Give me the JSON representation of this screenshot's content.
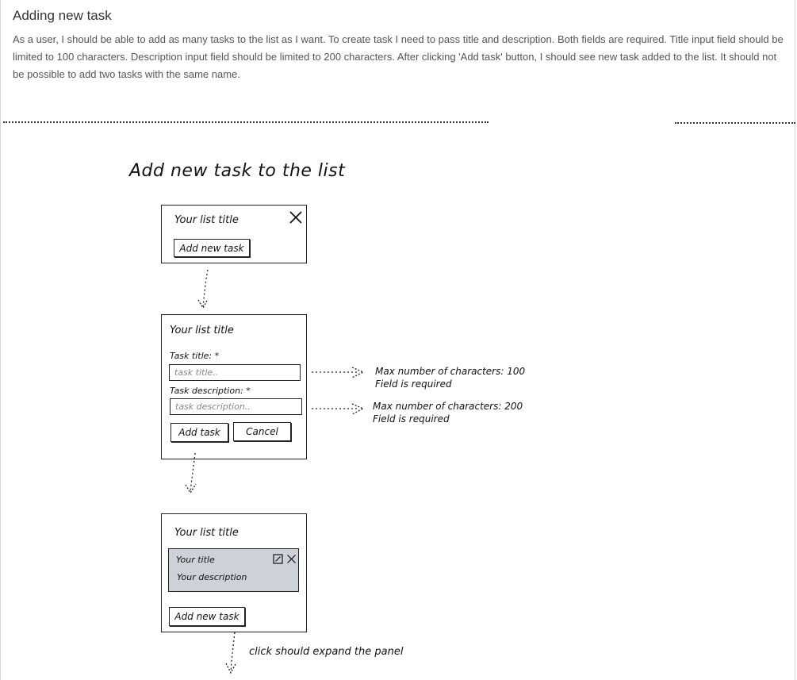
{
  "story": {
    "title": "Adding new task",
    "description": "As a user, I should be able to add as many tasks to the list as I want. To create task I need to pass title and description. Both fields are required. Title input field should be limited to 100 characters. Description input field should be limited to 200 characters. After clicking 'Add task' button, I should see new task added to the list. It should not be possible to add two tasks with the same name."
  },
  "sketch": {
    "heading": "Add new task to the list",
    "step1": {
      "list_title": "Your list title",
      "add_button": "Add new task",
      "close_icon": "close-icon"
    },
    "step2": {
      "list_title": "Your list title",
      "title_label": "Task title: *",
      "title_placeholder": "task title..",
      "description_label": "Task description: *",
      "description_placeholder": "task description..",
      "add_button": "Add task",
      "cancel_button": "Cancel",
      "title_note_line1": "Max number of characters: 100",
      "title_note_line2": "Field is required",
      "description_note_line1": "Max number of characters: 200",
      "description_note_line2": "Field is required"
    },
    "step3": {
      "list_title": "Your list title",
      "task_title": "Your title",
      "task_description": "Your description",
      "add_button": "Add new task",
      "edit_icon": "edit-icon",
      "delete_icon": "close-icon",
      "card_color": "#cdd2d8"
    },
    "footer_note": "click should expand the panel"
  }
}
